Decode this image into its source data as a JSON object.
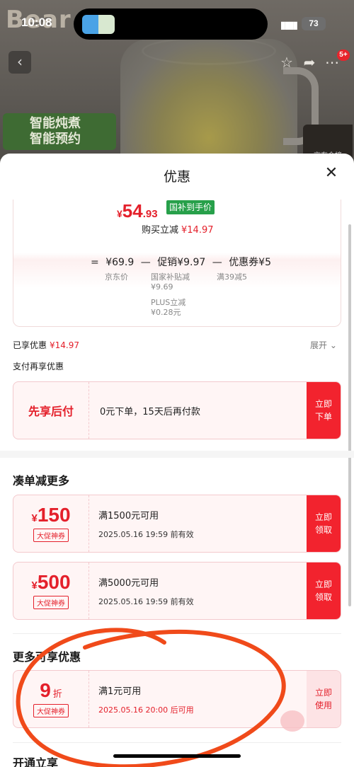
{
  "status_bar": {
    "time": "10:08",
    "signal": "▮▮▮▮",
    "battery": "73"
  },
  "product": {
    "brand_text": "Bear",
    "promo_lines": [
      "智能炖煮",
      "智能预约"
    ],
    "badge_text": "京东金榜",
    "notification_count": "5+"
  },
  "sheet": {
    "title": "优惠",
    "close_icon": "✕",
    "summary": {
      "price_currency": "¥",
      "price_int": "54",
      "price_dec": ".93",
      "price_tag": "国补到手价",
      "instant_cut_label": "购买立减",
      "instant_cut_value": "¥14.97",
      "formula": {
        "eq": "=",
        "base": "¥69.9",
        "minus1": "—",
        "promo": "促销¥9.97",
        "minus2": "—",
        "coupon": "优惠券¥5",
        "base_label": "京东价",
        "promo_sub1_label": "国家补贴减",
        "promo_sub1_value": "¥9.69",
        "promo_sub2_label": "PLUS立减",
        "promo_sub2_value": "¥0.28元",
        "coupon_label": "满39减5"
      }
    },
    "enjoyed_label": "已享优惠",
    "enjoyed_value": "¥14.97",
    "expand_label": "展开",
    "pay_more_label": "支付再享优惠",
    "bnpl": {
      "label": "先享后付",
      "desc": "0元下单，15天后再付款",
      "cta": "立即下单"
    },
    "section_more_orders": "凑单减更多",
    "coupons": [
      {
        "currency": "¥",
        "amount": "150",
        "tag": "大促神券",
        "condition": "满1500元可用",
        "validity": "2025.05.16 19:59 前有效",
        "cta": "立即领取"
      },
      {
        "currency": "¥",
        "amount": "500",
        "tag": "大促神券",
        "condition": "满5000元可用",
        "validity": "2025.05.16 19:59 前有效",
        "cta": "立即领取"
      }
    ],
    "section_more_offers": "更多可享优惠",
    "discount_coupon": {
      "amount": "9",
      "unit": "折",
      "tag": "大促神券",
      "condition": "满1元可用",
      "validity": "2025.05.16 20:00 后可用",
      "cta": "立即使用"
    },
    "section_next": "开通立享",
    "colors": {
      "accent_red": "#E4202B",
      "cta_red": "#F2232E",
      "gov_green": "#27A04A",
      "annotation_orange": "#F04A1A"
    }
  }
}
